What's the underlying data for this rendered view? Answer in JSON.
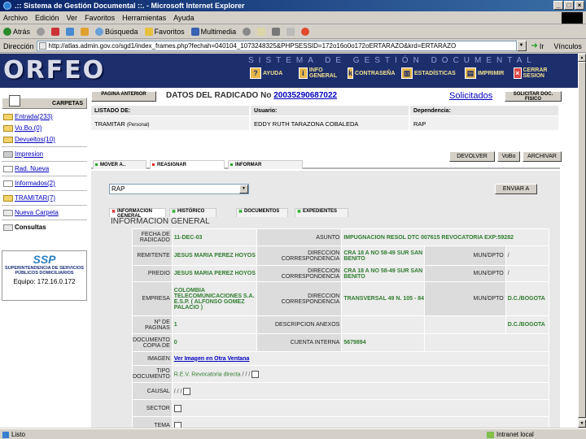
{
  "window": {
    "title": ".:: Sistema de Gestión Documental ::. - Microsoft Internet Explorer"
  },
  "menu": [
    "Archivo",
    "Edición",
    "Ver",
    "Favoritos",
    "Herramientas",
    "Ayuda"
  ],
  "toolbar": {
    "back": "Atrás",
    "search": "Búsqueda",
    "favorites": "Favoritos",
    "multimedia": "Multimedia"
  },
  "address": {
    "label": "Dirección",
    "url": "http://atlas.admin.gov.co/sgd1/index_frames.php?fechah=040104_1073248325&PHPSESSID=172o16o0o172oERTARAZO&krd=ERTARAZO",
    "go": "Ir",
    "links": "Vínculos"
  },
  "banner": {
    "logo": "ORFEO",
    "subtitle": "SISTEMA DE GESTIÓN DOCUMENTAL",
    "nav": [
      {
        "icon": "help-icon",
        "label": "AYUDA"
      },
      {
        "icon": "info-icon",
        "label": "INFO GENERAL"
      },
      {
        "icon": "key-icon",
        "label": "CONTRASEÑA"
      },
      {
        "icon": "stats-icon",
        "label": "ESTADÍSTICAS"
      },
      {
        "icon": "printer-icon",
        "label": "IMPRIMIR"
      },
      {
        "icon": "close-session-icon",
        "label": "CERRAR SESION"
      }
    ]
  },
  "sidebar": {
    "header": "CARPETAS",
    "folders": [
      {
        "label": "Entrada(233)"
      },
      {
        "label": "Vo.Bo.(0)"
      },
      {
        "label": "Devueltos(10)"
      }
    ],
    "links": [
      {
        "label": "Impresion"
      },
      {
        "label": "Rad. Nueva"
      },
      {
        "label": "Informados(2)"
      },
      {
        "label": "TRAMITAR(7)"
      },
      {
        "label": "Nueva Carpeta"
      },
      {
        "label": "Consultas"
      }
    ],
    "ssp": {
      "logo": "SSP",
      "name": "SUPERINTENDENCIA DE SERVICIOS PÚBLICOS DOMICILIARIOS",
      "equipo": "Equipo: 172.16.0.172"
    }
  },
  "main": {
    "prev_page": "PAGINA ANTERIOR",
    "title": "DATOS DEL RADICADO No",
    "radicado": "20035290687022",
    "solicitados": "Solicitados",
    "solicitar": "SOLICITAR DOC. FISICO",
    "header_labels": {
      "listado": "LISTADO DE:",
      "usuario": "Usuario:",
      "dependencia": "Dependencia:"
    },
    "header_values": {
      "listado": "TRAMITAR",
      "listado_note": "(Personal)",
      "usuario": "EDDY RUTH TARAZONA COBALEDA",
      "dependencia": "RAP"
    },
    "actions": [
      "DEVOLVER",
      "VoBo",
      "ARCHIVAR"
    ],
    "tabs": [
      "MOVER A..",
      "REASIGNAR",
      "INFORMAR"
    ],
    "select_value": "RAP",
    "send": "ENVIAR A",
    "info_tabs": [
      "INFORMACION GENERAL",
      "HISTÓRICO",
      "DOCUMENTOS",
      "EXPEDIENTES"
    ],
    "info_title": "INFORMACION GENERAL"
  },
  "info": {
    "fecha_label": "FECHA DE RADICADO",
    "fecha": "11-DEC-03",
    "asunto_label": "ASUNTO",
    "asunto": "IMPUGNACION RESOL DTC 007615 REVOCATORIA EXP:59282",
    "remitente_label": "REMITENTE",
    "remitente": "JESUS MARIA PEREZ HOYOS",
    "dir_label": "DIRECCION CORRESPONDENCIA",
    "dir1": "CRA 18 A NO 58-49 SUR SAN BENITO",
    "mun_label": "MUN/DPTO",
    "mun1": "/",
    "predio_label": "PREDIO",
    "predio": "JESUS MARIA PEREZ HOYOS",
    "dir2": "CRA 18 A NO 58-49 SUR SAN BENITO",
    "mun2": "/",
    "empresa_label": "EMPRESA",
    "empresa": "COLOMBIA TELECOMUNICACIONES S.A. E.S.P. ( ALFONSO GOMEZ PALACIO )",
    "dir3": "TRANSVERSAL 49 N. 105 - 84",
    "mun3": "D.C./BOGOTA",
    "paginas_label": "Nº DE PAGINAS",
    "paginas": "1",
    "anexos_label": "DESCRIPCION ANEXOS",
    "anexos": "",
    "mun4": "D.C./BOGOTA",
    "copia_label": "DOCUMENTO COPIA DE",
    "copia": "0",
    "cuenta_label": "CUENTA INTERNA",
    "cuenta": "5679894",
    "imagen_label": "IMAGEN",
    "imagen_link": "Ver Imagen en Otra Ventana",
    "tipo_label": "TIPO DOCUMENTO",
    "tipo": "R.E.V. Revocatoria directa",
    "tipo_sep": "/ / /",
    "causal_label": "CAUSAL",
    "causal": "/ / /",
    "sector_label": "SECTOR",
    "tema_label": "TEMA"
  },
  "status": {
    "left": "Listo",
    "right": "Intranet local"
  }
}
